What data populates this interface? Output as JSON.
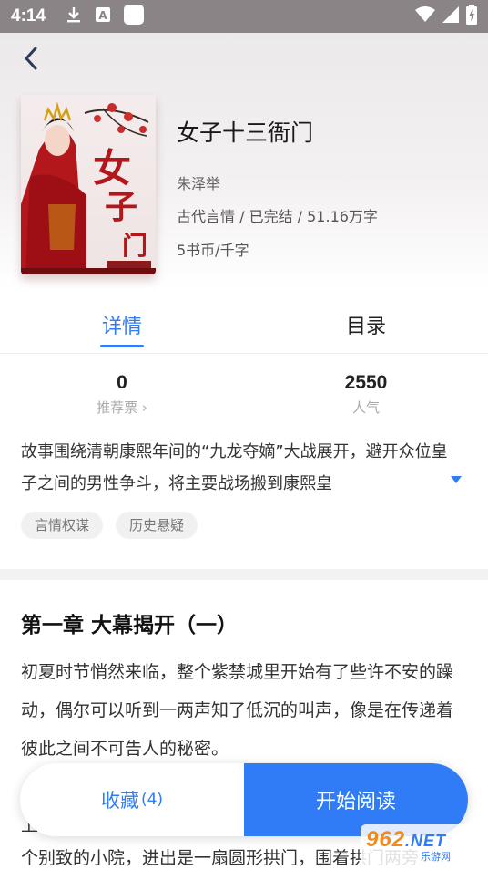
{
  "status_bar": {
    "time": "4:14"
  },
  "book": {
    "title": "女子十三衙门",
    "author": "朱泽举",
    "meta": "古代言情 / 已完结 / 51.16万字",
    "price": "5书币/千字",
    "cover_alt": "女子十三衙门"
  },
  "tabs": [
    {
      "label": "详情"
    },
    {
      "label": "目录"
    }
  ],
  "stats": {
    "recommend": {
      "value": "0",
      "label": "推荐票 ›"
    },
    "popularity": {
      "value": "2550",
      "label": "人气"
    }
  },
  "description": "故事围绕清朝康熙年间的“九龙夺嫡”大战展开，避开众位皇子之间的男性争斗，将主要战场搬到康熙皇",
  "tags": [
    "言情权谋",
    "历史悬疑"
  ],
  "chapter": {
    "title": "第一章 大幕揭开（一）",
    "text": "  初夏时节悄然来临，整个紫禁城里开始有了些许不安的躁动，偶尔可以听到一两声知了低沉的叫声，像是在传递着彼此之间不可告人的秘密。",
    "text_hidden_line": "上",
    "text_last_line": "个别致的小院，进出是一扇圆形拱门，围着拱门两旁"
  },
  "actions": {
    "collect_label": "收藏",
    "collect_count": "(4)",
    "read_label": "开始阅读"
  },
  "watermark": {
    "brand": "962",
    "suffix": ".NET",
    "sub": "乐游网"
  },
  "colors": {
    "accent": "#2f7cf6",
    "status_bar": "#8a8486"
  }
}
